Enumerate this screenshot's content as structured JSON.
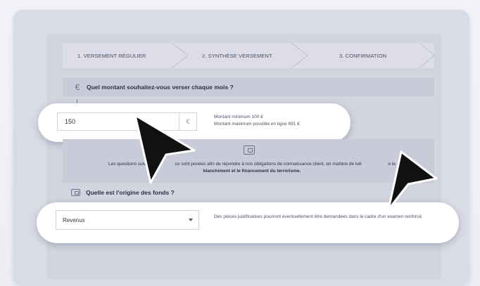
{
  "stepper": {
    "steps": [
      {
        "label": "1. VERSEMENT RÉGULIER"
      },
      {
        "label": "2. SYNTHÈSE VERSEMENT"
      },
      {
        "label": "3. CONFIRMATION"
      }
    ]
  },
  "question1": {
    "icon": "euro-icon",
    "text": "Quel montant souhaitez-vous verser chaque mois ?"
  },
  "amount": {
    "value": "150",
    "unit": "€",
    "help_min": "Montant minimum 100 €",
    "help_max": "Montant maximum possible en ligne 691 €"
  },
  "info": {
    "icon": "wallet-icon",
    "text_part1": "Les questions suivan",
    "text_part2": "us sont posées afin de répondre à nos obligations de connaissance client, en matière de lutt",
    "text_part3": "e le",
    "text_line2": "blanchiment et le financement du terrorisme."
  },
  "question2": {
    "icon": "wallet-icon",
    "text": "Quelle est l'origine des fonds ?"
  },
  "origin": {
    "selected": "Revenus",
    "help": "Des pièces justificatives pourront éventuellement être demandées dans le cadre d'un examen renforcé."
  },
  "colors": {
    "panel": "#d9dbe6",
    "highlight": "#ffffff",
    "arrow": "#111111"
  }
}
